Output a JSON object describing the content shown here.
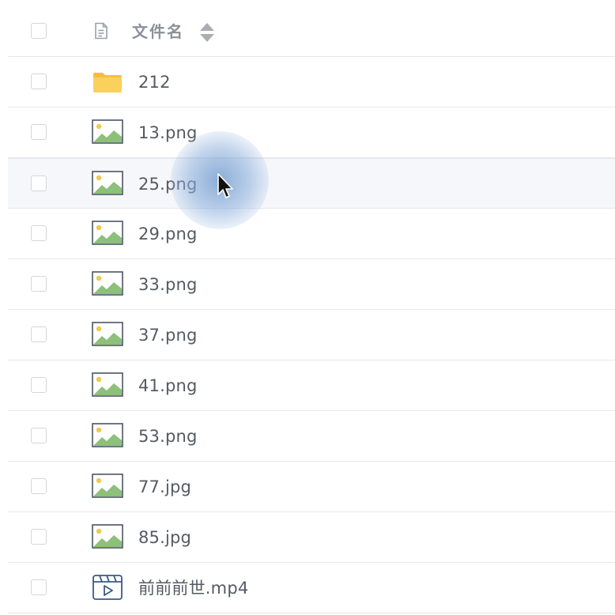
{
  "header": {
    "column_name_label": "文件名",
    "type_icon": "document-icon",
    "sort_icon": "sort-up-down-icon"
  },
  "files": [
    {
      "name": "212",
      "icon": "folder-icon"
    },
    {
      "name": "13.png",
      "icon": "image-icon"
    },
    {
      "name": "25.png",
      "icon": "image-icon"
    },
    {
      "name": "29.png",
      "icon": "image-icon"
    },
    {
      "name": "33.png",
      "icon": "image-icon"
    },
    {
      "name": "37.png",
      "icon": "image-icon"
    },
    {
      "name": "41.png",
      "icon": "image-icon"
    },
    {
      "name": "53.png",
      "icon": "image-icon"
    },
    {
      "name": "77.jpg",
      "icon": "image-icon"
    },
    {
      "name": "85.jpg",
      "icon": "image-icon"
    },
    {
      "name": "前前前世.mp4",
      "icon": "video-icon"
    }
  ],
  "hovered_file": "25.png",
  "colors": {
    "text": "#555a63",
    "header_text": "#8b9099",
    "border": "#e4e7ed",
    "hover_bg": "#f5f7fa",
    "folder": "#f7c948",
    "image_frame": "#4b5563",
    "image_hill": "#8dc07a",
    "image_sun": "#f2c94c",
    "video_stroke": "#3c5a86"
  }
}
